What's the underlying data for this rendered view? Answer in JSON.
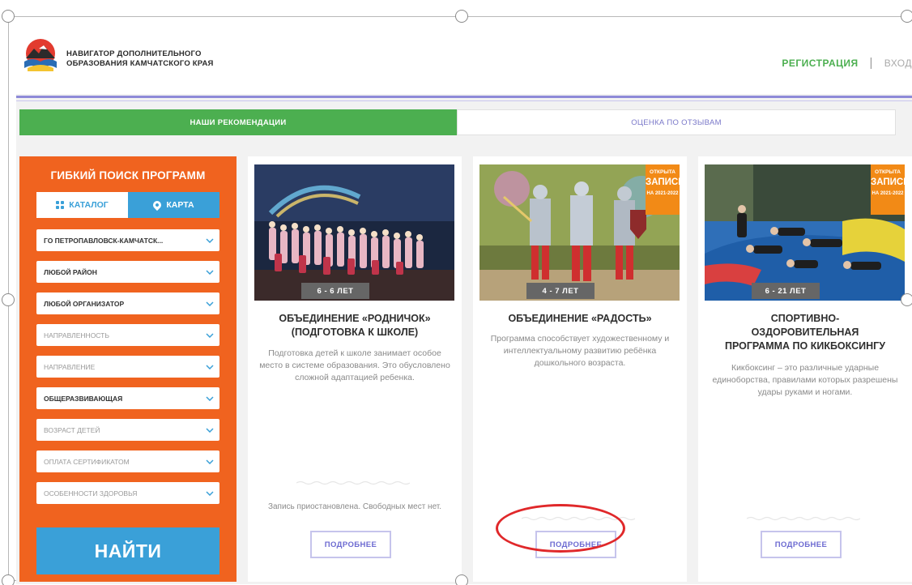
{
  "header": {
    "brand_line1": "НАВИГАТОР ДОПОЛНИТЕЛЬНОГО",
    "brand_line2": "ОБРАЗОВАНИЯ КАМЧАТСКОГО КРАЯ",
    "register_label": "РЕГИСТРАЦИЯ",
    "separator": "|",
    "login_label": "ВХОД"
  },
  "tabs": [
    {
      "label": "НАШИ РЕКОМЕНДАЦИИ",
      "active": true
    },
    {
      "label": "ОЦЕНКА ПО ОТЗЫВАМ",
      "active": false
    }
  ],
  "sidebar": {
    "title": "ГИБКИЙ ПОИСК ПРОГРАММ",
    "catalog_label": "КАТАЛОГ",
    "map_label": "КАРТА",
    "filters": [
      {
        "value": "ГО ПЕТРОПАВЛОВСК-КАМЧАТСК...",
        "selected": true
      },
      {
        "value": "ЛЮБОЙ РАЙОН",
        "selected": true
      },
      {
        "value": "ЛЮБОЙ ОРГАНИЗАТОР",
        "selected": true
      },
      {
        "value": "НАПРАВЛЕННОСТЬ",
        "selected": false
      },
      {
        "value": "НАПРАВЛЕНИЕ",
        "selected": false
      },
      {
        "value": "ОБЩЕРАЗВИВАЮЩАЯ",
        "selected": true
      },
      {
        "value": "ВОЗРАСТ ДЕТЕЙ",
        "selected": false
      },
      {
        "value": "ОПЛАТА СЕРТИФИКАТОМ",
        "selected": false
      },
      {
        "value": "ОСОБЕННОСТИ ЗДОРОВЬЯ",
        "selected": false
      }
    ],
    "find_label": "НАЙТИ"
  },
  "cards": [
    {
      "age": "6 - 6 ЛЕТ",
      "title": "ОБЪЕДИНЕНИЕ «РОДНИЧОК» (ПОДГОТОВКА К ШКОЛЕ)",
      "description": "Подготовка детей к школе занимает особое место в системе образования. Это обусловлено сложной адаптацией ребенка.",
      "status": "Запись приостановлена. Свободных мест нет.",
      "more_label": "ПОДРОБНЕЕ"
    },
    {
      "age": "4 - 7 ЛЕТ",
      "badge": {
        "line1": "ОТКРЫТА",
        "line2": "ЗАПИСЬ",
        "line3": "НА 2021-2022"
      },
      "title": "ОБЪЕДИНЕНИЕ «РАДОСТЬ»",
      "description": "Программа способствует художественному и интеллектуальному развитию ребёнка дошкольного возраста.",
      "more_label": "ПОДРОБНЕЕ"
    },
    {
      "age": "6 - 21 ЛЕТ",
      "badge": {
        "line1": "ОТКРЫТА",
        "line2": "ЗАПИСЬ",
        "line3": "НА 2021-2022"
      },
      "title": "СПОРТИВНО-ОЗДОРОВИТЕЛЬНАЯ ПРОГРАММА ПО КИКБОКСИНГУ",
      "description": "Кикбоксинг – это различные ударные единоборства, правилами которых разрешены удары руками и ногами.",
      "more_label": "ПОДРОБНЕЕ"
    }
  ],
  "colors": {
    "accent_green": "#4caf50",
    "sidebar_orange": "#f0631f",
    "button_blue": "#3aa0d8",
    "link_purple": "#6c6ad1",
    "badge_orange": "#f28a16",
    "annotation_red": "#e0282a"
  }
}
